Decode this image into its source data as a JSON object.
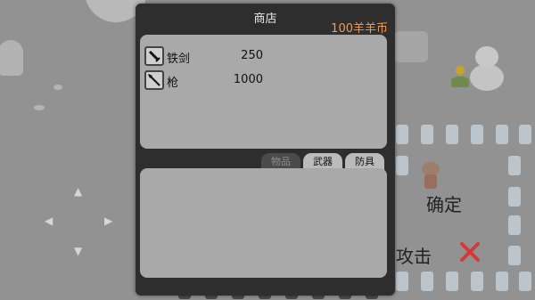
{
  "shop": {
    "title": "商店",
    "currency": "100羊羊币",
    "items": [
      {
        "name": "铁剑",
        "price": "250",
        "icon": "sword-icon"
      },
      {
        "name": "枪",
        "price": "1000",
        "icon": "spear-icon"
      }
    ],
    "tabs": [
      {
        "label": "物品",
        "active": false
      },
      {
        "label": "武器",
        "active": true
      },
      {
        "label": "防具",
        "active": true
      }
    ]
  },
  "controls": {
    "dpad": {
      "up": "▲",
      "down": "▼",
      "left": "◀",
      "right": "▶"
    },
    "confirm_label": "确定",
    "attack_label": "攻击",
    "close": "close-icon"
  },
  "colors": {
    "currency": "#f29a55",
    "close": "#d23a3a",
    "panel": "#a9a9a9",
    "window": "#2e2e2e"
  }
}
